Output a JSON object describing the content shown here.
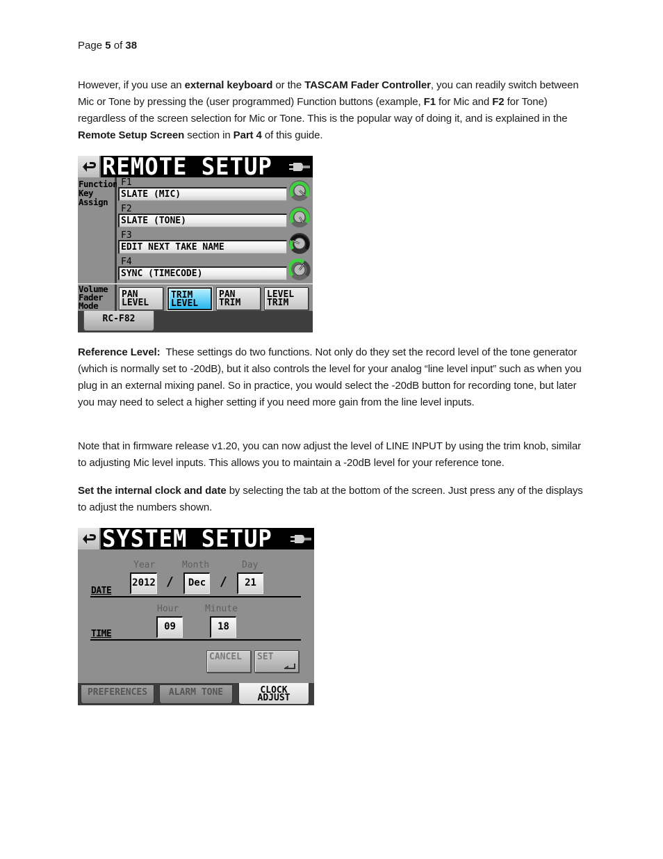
{
  "page": {
    "label": "Page",
    "current": "5",
    "of": "of",
    "total": "38"
  },
  "paragraphs": {
    "p1": {
      "t1": "However, if you use an ",
      "b1": "external keyboard",
      "t2": " or the ",
      "b2": "TASCAM Fader Controller",
      "t3": ", you can readily switch between Mic or Tone by pressing the (user programmed) Function buttons (example, ",
      "b3": "F1",
      "t4": " for Mic and ",
      "b4": "F2",
      "t5": " for Tone) regardless of the screen selection for Mic or Tone. This is the popular way of doing it, and is explained in the ",
      "b5": "Remote Setup Screen",
      "t6": " section in ",
      "b6": "Part 4",
      "t7": " of this guide."
    },
    "p2": {
      "b1": "Reference Level:",
      "t1": "  These settings do two functions. Not only do they set the record level of the tone generator (which is normally set to -20dB), but it also controls the level for your analog “line level input” such as when you plug in an external mixing panel. So in practice, you would select the -20dB button for recording tone, but later you may need to select a higher setting if you need more gain from the line level inputs."
    },
    "p3": {
      "t1": "Note that in firmware release v1.20, you can now adjust the level of LINE INPUT by using the trim knob, similar to adjusting Mic level inputs. This allows you to maintain a -20dB level for your reference tone."
    },
    "p4": {
      "b1": "Set the internal clock and date",
      "t1": " by selecting the tab at the bottom of the screen. Just press any of the displays to adjust the numbers shown."
    }
  },
  "remote_setup": {
    "title": "REMOTE SETUP",
    "section_function": [
      "Function",
      "Key",
      "Assign"
    ],
    "function_keys": [
      {
        "label": "F1",
        "value": "SLATE (MIC)",
        "knob": "green-ring"
      },
      {
        "label": "F2",
        "value": "SLATE (TONE)",
        "knob": "green-ring"
      },
      {
        "label": "F3",
        "value": "EDIT NEXT TAKE NAME",
        "knob": "dark-ring"
      },
      {
        "label": "F4",
        "value": "SYNC (TIMECODE)",
        "knob": "green-ring"
      }
    ],
    "section_volume": [
      "Volume",
      "Fader",
      "Mode"
    ],
    "fader_modes": [
      {
        "line1": "PAN",
        "line2": "LEVEL",
        "active": false
      },
      {
        "line1": "TRIM",
        "line2": "LEVEL",
        "active": true
      },
      {
        "line1": "PAN",
        "line2": "TRIM",
        "active": false
      },
      {
        "line1": "LEVEL",
        "line2": "TRIM",
        "active": false
      }
    ],
    "tab": "RC-F82",
    "colors": {
      "active_button": "#27b6ee",
      "knob_ring": "#3fd03f"
    }
  },
  "system_setup": {
    "title": "SYSTEM SETUP",
    "date_label": "DATE",
    "time_label": "TIME",
    "year_label": "Year",
    "month_label": "Month",
    "day_label": "Day",
    "year": "2012",
    "month": "Dec",
    "day": "21",
    "separator": "/",
    "hour_label": "Hour",
    "minute_label": "Minute",
    "hour": "09",
    "minute": "18",
    "cancel": "CANCEL",
    "set": "SET",
    "tabs": [
      {
        "label": "PREFERENCES",
        "active": false
      },
      {
        "label": "ALARM TONE",
        "active": false
      },
      {
        "label": "CLOCK ADJUST",
        "line1": "CLOCK",
        "line2": "ADJUST",
        "active": true
      }
    ]
  }
}
